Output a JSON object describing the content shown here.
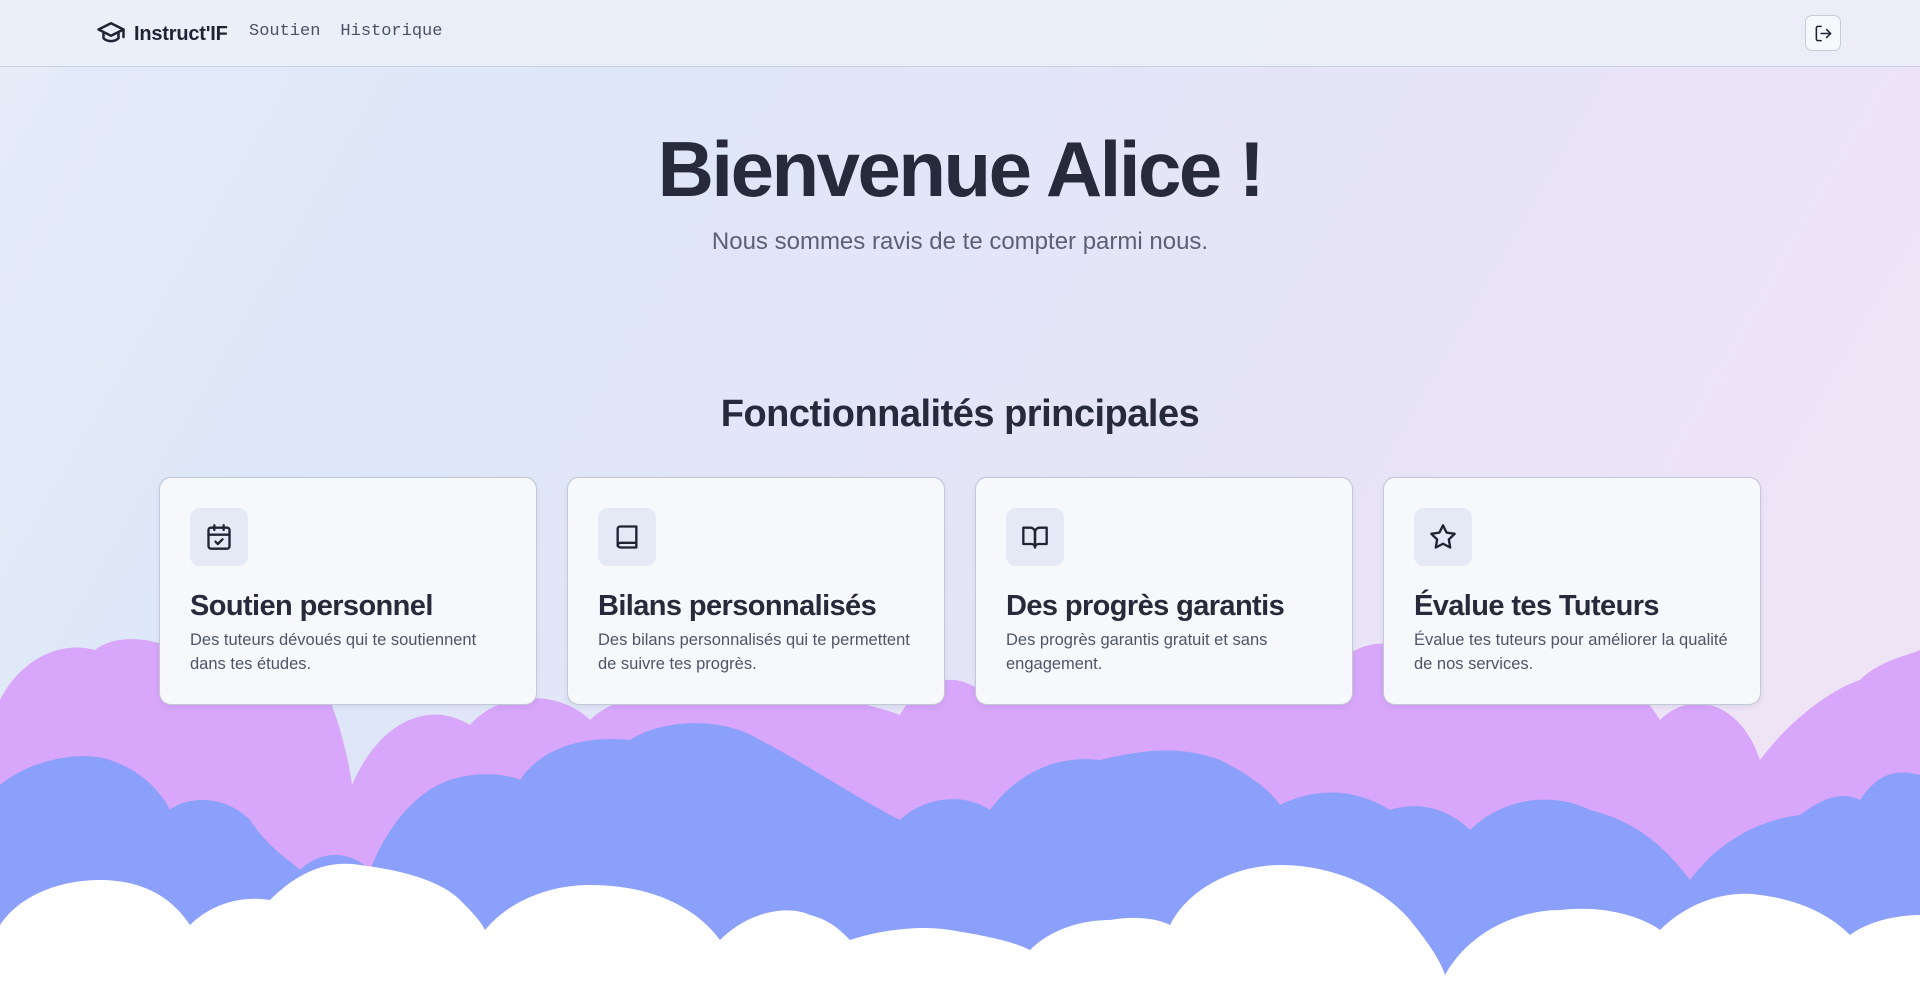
{
  "nav": {
    "brand": "Instruct'IF",
    "links": [
      "Soutien",
      "Historique"
    ],
    "logout_icon": "logout-icon"
  },
  "hero": {
    "title": "Bienvenue Alice !",
    "subtitle": "Nous sommes ravis de te compter parmi nous."
  },
  "features": {
    "title": "Fonctionnalités principales",
    "cards": [
      {
        "icon": "calendar-check-icon",
        "title": "Soutien personnel",
        "description": "Des tuteurs dévoués qui te soutiennent dans tes études."
      },
      {
        "icon": "book-icon",
        "title": "Bilans personnalisés",
        "description": "Des bilans personnalisés qui te permettent de suivre tes progrès."
      },
      {
        "icon": "book-open-icon",
        "title": "Des progrès garantis",
        "description": "Des progrès garantis gratuit et sans engagement."
      },
      {
        "icon": "star-icon",
        "title": "Évalue tes Tuteurs",
        "description": "Évalue tes tuteurs pour améliorer la qualité de nos services."
      }
    ]
  },
  "colors": {
    "text": "#262a3a",
    "cloud_pink": "#d8a6fb",
    "cloud_blue": "#8ba0fb",
    "cloud_white": "#ffffff"
  }
}
